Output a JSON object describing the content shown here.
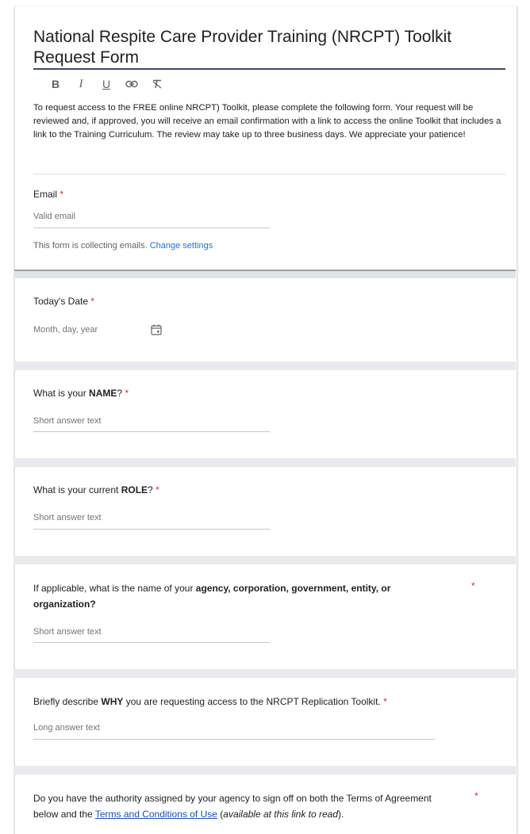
{
  "form": {
    "title": "National Respite Care Provider Training (NRCPT) Toolkit Request Form",
    "toolbar": {
      "bold": "B",
      "italic": "I",
      "underline": "U",
      "link": "⦾",
      "clear": "⨯"
    },
    "description": "To request access to the FREE online NRCPT)  Toolkit, please complete the following form. Your request will be reviewed and, if approved, you will receive an email confirmation with a link to access the online Toolkit that includes a link to the Training Curriculum. The review may take up to three business days. We appreciate your patience!"
  },
  "email": {
    "label": "Email",
    "required_mark": "*",
    "placeholder": "Valid email",
    "note": "This form is collecting emails.",
    "note_link": "Change settings"
  },
  "questions": {
    "date": {
      "label": "Today's Date",
      "placeholder": "Month, day, year"
    },
    "name": {
      "label_pre": "What is your ",
      "label_bold": "NAME",
      "label_post": "?",
      "placeholder": "Short answer text"
    },
    "role": {
      "label_pre": "What is your current ",
      "label_bold": "ROLE",
      "label_post": "?",
      "placeholder": "Short answer text"
    },
    "agency": {
      "label_pre": "If applicable, what is the name of your ",
      "label_bold": "agency, corporation, government, entity, or organization?",
      "placeholder": "Short answer text"
    },
    "why": {
      "label_pre": "Briefly describe ",
      "label_bold": "WHY",
      "label_post": " you are requesting access to the  NRCPT Replication Toolkit.",
      "placeholder": "Long answer text"
    },
    "authority": {
      "label_pre": "Do you have the authority assigned by your agency to sign off on both the Terms of Agreement below and the ",
      "link": "Terms and Conditions of Use",
      "label_mid": " (",
      "italic": "available at this link to read",
      "label_post": ")."
    }
  },
  "colors": {
    "required": "#d93025",
    "link": "#1a73e8",
    "band": "#e8eaed"
  },
  "icons": {
    "date": "calendar-icon"
  }
}
